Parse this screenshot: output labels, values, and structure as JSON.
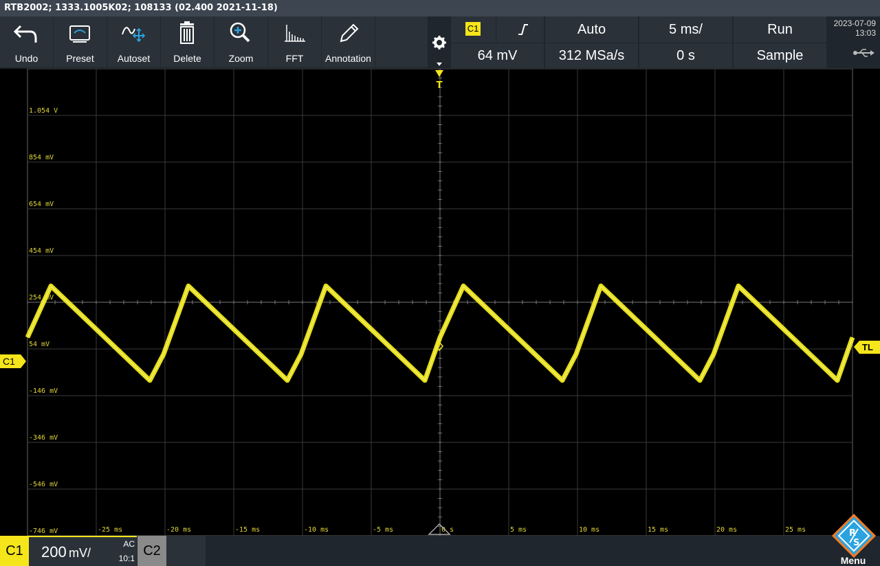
{
  "titlebar": {
    "text": "RTB2002; 1333.1005K02; 108133 (02.400 2021-11-18)"
  },
  "toolbar": {
    "buttons": [
      {
        "label": "Undo",
        "icon": "undo-icon"
      },
      {
        "label": "Preset",
        "icon": "preset-icon"
      },
      {
        "label": "Autoset",
        "icon": "autoset-icon"
      },
      {
        "label": "Delete",
        "icon": "trash-icon"
      },
      {
        "label": "Zoom",
        "icon": "zoom-icon"
      },
      {
        "label": "FFT",
        "icon": "fft-icon"
      },
      {
        "label": "Annotation",
        "icon": "pencil-icon"
      }
    ]
  },
  "status": {
    "trigger_source": "C1",
    "trigger_mode": "Auto",
    "timebase": "5 ms/",
    "run_state": "Run",
    "trigger_level": "64 mV",
    "sample_rate": "312 MSa/s",
    "horizontal_position": "0 s",
    "acquisition_mode": "Sample",
    "date": "2023-07-09",
    "time": "13:03"
  },
  "screen": {
    "y_labels": [
      "1.054 V",
      "854 mV",
      "654 mV",
      "454 mV",
      "254 mV",
      "54 mV",
      "-146 mV",
      "-346 mV",
      "-546 mV",
      "-746 mV"
    ],
    "x_labels": [
      "-25 ms",
      "-20 ms",
      "-15 ms",
      "-10 ms",
      "-5 ms",
      "0 s",
      "5 ms",
      "10 ms",
      "15 ms",
      "20 ms",
      "25 ms"
    ],
    "channel_marker": "C1",
    "trigger_level_marker": "TL",
    "trigger_marker": "T"
  },
  "chart_data": {
    "type": "line",
    "title": "",
    "xlabel": "",
    "ylabel": "",
    "xlim": [
      -30,
      30
    ],
    "ylim": [
      -800,
      1154
    ],
    "grid": true,
    "series": [
      {
        "x": [
          -30,
          -28.3,
          -21.1,
          -20.1,
          -18.3,
          -11.1,
          -10.1,
          -8.3,
          -1.1,
          0,
          1.7,
          8.9,
          9.9,
          11.7,
          18.9,
          19.9,
          21.7,
          28.9,
          30
        ],
        "values": [
          30,
          245,
          -150,
          -40,
          245,
          -150,
          -40,
          245,
          -150,
          30,
          245,
          -150,
          -40,
          245,
          -150,
          -40,
          245,
          -150,
          30
        ]
      }
    ]
  },
  "bottom": {
    "channel1_label": "C1",
    "channel1_scale": "200",
    "channel1_unit": "mV/",
    "channel1_coupling": "AC",
    "channel1_probe": "10:1",
    "channel2_label": "C2",
    "menu_label": "Menu"
  },
  "colors": {
    "trace": "#f0ea1a",
    "marker": "#f5e51b",
    "panel": "#2a3139",
    "toolbar_bg": "#1f262d",
    "titlebar": "#3c4550",
    "rs_logo": "#2aa3e0",
    "rs_border": "#f47b20"
  }
}
